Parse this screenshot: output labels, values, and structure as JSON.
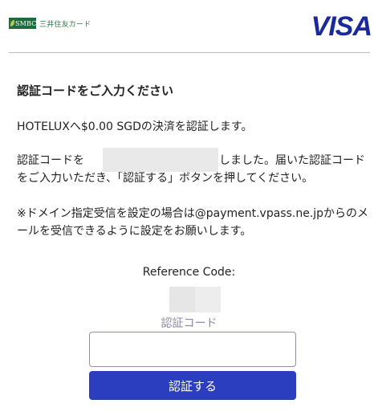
{
  "header": {
    "smbc_mark_text": "SMBC",
    "smbc_name": "三井住友カード",
    "visa_text": "VISA"
  },
  "colors": {
    "smbc_green": "#1f6b3f",
    "visa_blue": "#1a2a9a",
    "button_blue": "#2c3ec0",
    "label_grey": "#8a8aa8"
  },
  "main": {
    "heading": "認証コードをご入力ください",
    "paragraph1": "HOTELUXへ$0.00 SGDの決済を認証します。",
    "paragraph2": "認証コードを　　　　　　　　　お送りしました。届いた認証コードをご入力いただき、「認証する」ボタンを押してください。",
    "paragraph3": "※ドメイン指定受信を設定の場合は@payment.vpass.ne.jpからのメールを受信できるように設定をお願いします。",
    "reference_label": "Reference Code:",
    "code_label": "認証コード",
    "code_input_value": "",
    "submit_label": "認証する"
  }
}
